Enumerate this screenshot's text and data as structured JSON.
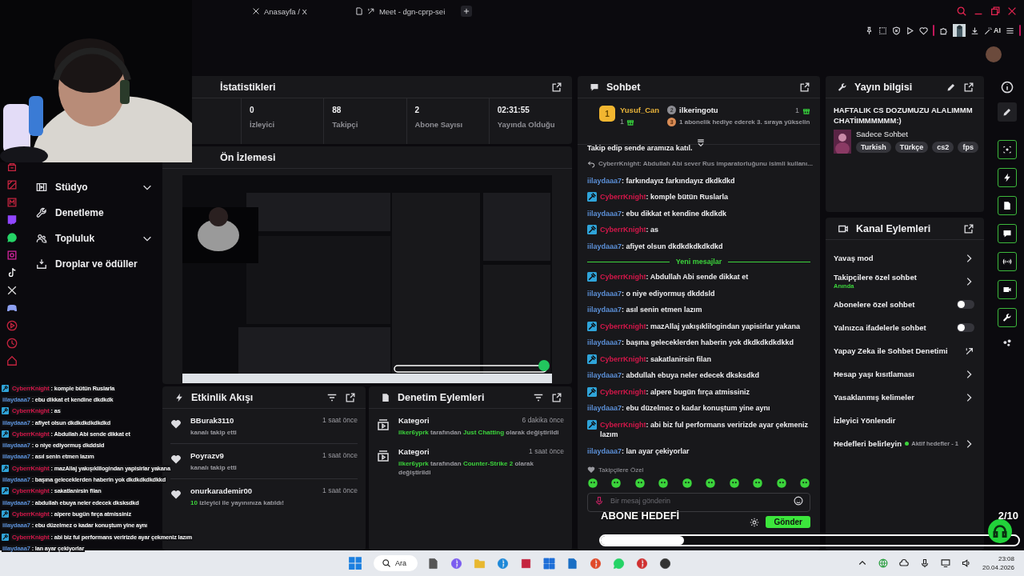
{
  "browser": {
    "tabs": [
      {
        "title": "Anasayfa / X"
      },
      {
        "title": "Meet - dgn-cprp-sei"
      }
    ],
    "toolbar_label": "AI"
  },
  "sidebar": {
    "items": [
      {
        "label": "Stüdyo",
        "expandable": true
      },
      {
        "label": "Denetleme",
        "expandable": false
      },
      {
        "label": "Topluluk",
        "expandable": true
      },
      {
        "label": "Droplar ve ödüller",
        "expandable": false
      }
    ]
  },
  "stats": {
    "title": "İstatistikleri",
    "cells": [
      {
        "value": "0",
        "label": "İzleyici"
      },
      {
        "value": "88",
        "label": "Takipçi"
      },
      {
        "value": "2",
        "label": "Abone Sayısı"
      },
      {
        "value": "02:31:55",
        "label": "Yayında Olduğu"
      }
    ]
  },
  "preview": {
    "title": "Ön İzlemesi",
    "kind": "picture"
  },
  "activity": {
    "title": "Etkinlik Akışı",
    "events": [
      {
        "kind": "follow",
        "user": "BBurak3110",
        "time": "1 saat önce",
        "text": "kanalı takip etti"
      },
      {
        "kind": "follow",
        "user": "Poyrazv9",
        "time": "1 saat önce",
        "text": "kanalı takip etti"
      },
      {
        "kind": "raid",
        "user": "onurkarademir00",
        "time": "1 saat önce",
        "count": "10",
        "text": "izleyici ile yayınınıza katıldı!"
      }
    ]
  },
  "mod_actions": {
    "title": "Denetim Eylemleri",
    "items": [
      {
        "title": "Kategori",
        "time": "6 dakika önce",
        "actor": "ilker6yprk",
        "middle": "tarafından",
        "value": "Just Chatting",
        "tail": "olarak değiştirildi"
      },
      {
        "title": "Kategori",
        "time": "1 saat önce",
        "actor": "ilker6yprk",
        "middle": "tarafından",
        "value": "Counter-Strike 2",
        "tail": "olarak değiştirildi"
      }
    ]
  },
  "chat": {
    "title": "Sohbet",
    "leaders": [
      {
        "rank": "1",
        "name": "Yusuf_Can",
        "count": "1"
      },
      {
        "rank": "2",
        "name": "ilkeringotu",
        "count": "1"
      },
      {
        "rank": "3",
        "text": "1 abonelik hediye ederek 3. sıraya yükselin"
      }
    ],
    "messages": [
      {
        "kind": "notice",
        "text": "Takip edip sende aramıza katıl."
      },
      {
        "kind": "reply",
        "text": "CyberrKnight: Abdullah Abi sever Rus imparatorluğunu isimli kullanı..."
      },
      {
        "kind": "message",
        "user": "iilaydaaa7",
        "color": "#5b8fd6",
        "moderator": false,
        "text": ": farkındayız farkındayız dkdkdkd"
      },
      {
        "kind": "message",
        "user": "CyberrKnight",
        "color": "#d4174a",
        "moderator": true,
        "text": ": komple bütün Ruslarla"
      },
      {
        "kind": "message",
        "user": "iilaydaaa7",
        "color": "#5b8fd6",
        "moderator": false,
        "text": ": ebu dikkat et kendine dkdkdk"
      },
      {
        "kind": "message",
        "user": "CyberrKnight",
        "color": "#d4174a",
        "moderator": true,
        "text": ": as"
      },
      {
        "kind": "message",
        "user": "iilaydaaa7",
        "color": "#5b8fd6",
        "moderator": false,
        "text": ": afiyet olsun dkdkdkdkdkdkd"
      },
      {
        "kind": "divider",
        "text": "Yeni mesajlar"
      },
      {
        "kind": "message",
        "user": "CyberrKnight",
        "color": "#d4174a",
        "moderator": true,
        "text": ": Abdullah Abi sende dikkat et"
      },
      {
        "kind": "message",
        "user": "iilaydaaa7",
        "color": "#5b8fd6",
        "moderator": false,
        "text": ": o niye ediyormuş dkddsld"
      },
      {
        "kind": "message",
        "user": "iilaydaaa7",
        "color": "#5b8fd6",
        "moderator": false,
        "text": ": asıl senin etmen lazım"
      },
      {
        "kind": "message",
        "user": "CyberrKnight",
        "color": "#d4174a",
        "moderator": true,
        "text": ": mazAllaj yakışıklilogindan yapisirlar yakana"
      },
      {
        "kind": "message",
        "user": "iilaydaaa7",
        "color": "#5b8fd6",
        "moderator": false,
        "text": ": başına geleceklerden haberin yok dkdkdkdkdkkd"
      },
      {
        "kind": "message",
        "user": "CyberrKnight",
        "color": "#d4174a",
        "moderator": true,
        "text": ": sakatlanirsin filan"
      },
      {
        "kind": "message",
        "user": "iilaydaaa7",
        "color": "#5b8fd6",
        "moderator": false,
        "text": ": abdullah ebuya neler edecek dksksdkd"
      },
      {
        "kind": "message",
        "user": "CyberrKnight",
        "color": "#d4174a",
        "moderator": true,
        "text": ": alpere bugün fırça atmissiniz"
      },
      {
        "kind": "message",
        "user": "iilaydaaa7",
        "color": "#5b8fd6",
        "moderator": false,
        "text": ": ebu düzelmez o kadar konuştum yine aynı"
      },
      {
        "kind": "message",
        "user": "CyberrKnight",
        "color": "#d4174a",
        "moderator": true,
        "text": ": abi biz ful performans veririzde ayar çekmeniz lazım"
      },
      {
        "kind": "message",
        "user": "iilaydaaa7",
        "color": "#5b8fd6",
        "moderator": false,
        "text": ": lan ayar çekiyorlar"
      }
    ],
    "emote_section": "Takipçilere Özel",
    "placeholder": "Bir mesaj gönderin",
    "send": "Gönder"
  },
  "stream_info": {
    "title": "Yayın bilgisi",
    "stream_title": "HAFTALIK CS DOZUMUZU ALALIMMM CHATİIMMMMMM:)",
    "category": "Sadece Sohbet",
    "tags": [
      "Turkish",
      "Türkçe",
      "cs2",
      "fps"
    ]
  },
  "channel_actions": {
    "title": "Kanal Eylemleri",
    "items": [
      {
        "kind": "link",
        "label": "Yavaş mod"
      },
      {
        "kind": "link",
        "label": "Takipçilere özel sohbet",
        "sub": "Anında"
      },
      {
        "kind": "toggle",
        "label": "Abonelere özel sohbet",
        "on": false
      },
      {
        "kind": "toggle",
        "label": "Yalnızca ifadelerle sohbet",
        "on": false
      },
      {
        "kind": "external",
        "label": "Yapay Zeka ile Sohbet Denetimi"
      },
      {
        "kind": "link",
        "label": "Hesap yaşı kısıtlaması"
      },
      {
        "kind": "link",
        "label": "Yasaklanmış kelimeler"
      },
      {
        "kind": "plain",
        "label": "İzleyici Yönlendir"
      },
      {
        "kind": "link",
        "label": "Hedefleri belirleyin",
        "status": "Aktif hedefler - 1"
      }
    ]
  },
  "overlay_chat": [
    {
      "user": "CyberrKnight",
      "color": "#d4174a",
      "moderator": true,
      "text": ": komple bütün Ruslarla"
    },
    {
      "user": "iilaydaaa7",
      "color": "#5b8fd6",
      "moderator": false,
      "text": ": ebu dikkat et kendine dkdkdk"
    },
    {
      "user": "CyberrKnight",
      "color": "#d4174a",
      "moderator": true,
      "text": ": as"
    },
    {
      "user": "iilaydaaa7",
      "color": "#5b8fd6",
      "moderator": false,
      "text": ": afiyet olsun dkdkdkdkdkdkd"
    },
    {
      "user": "CyberrKnight",
      "color": "#d4174a",
      "moderator": true,
      "text": ": Abdullah Abi sende dikkat et"
    },
    {
      "user": "iilaydaaa7",
      "color": "#5b8fd6",
      "moderator": false,
      "text": ": o niye ediyormuş dkddsld"
    },
    {
      "user": "iilaydaaa7",
      "color": "#5b8fd6",
      "moderator": false,
      "text": ": asıl senin etmen lazım"
    },
    {
      "user": "CyberrKnight",
      "color": "#d4174a",
      "moderator": true,
      "text": ": mazAllaj yakışıklilogindan yapisirlar yakana"
    },
    {
      "user": "iilaydaaa7",
      "color": "#5b8fd6",
      "moderator": false,
      "text": ": başına geleceklerden haberin yok dkdkdkdkdkkd"
    },
    {
      "user": "CyberrKnight",
      "color": "#d4174a",
      "moderator": true,
      "text": ": sakatlanirsin filan"
    },
    {
      "user": "iilaydaaa7",
      "color": "#5b8fd6",
      "moderator": false,
      "text": ": abdullah ebuya neler edecek dksksdkd"
    },
    {
      "user": "CyberrKnight",
      "color": "#d4174a",
      "moderator": true,
      "text": ": alpere bugün fırça atmissiniz"
    },
    {
      "user": "iilaydaaa7",
      "color": "#5b8fd6",
      "moderator": false,
      "text": ": ebu düzelmez o kadar konuştum yine aynı"
    },
    {
      "user": "CyberrKnight",
      "color": "#d4174a",
      "moderator": true,
      "text": ": abi biz ful performans veririzde ayar çekmeniz lazım"
    },
    {
      "user": "iilaydaaa7",
      "color": "#5b8fd6",
      "moderator": false,
      "text": ": lan ayar çekiyorlar"
    }
  ],
  "goal": {
    "title": "ABONE HEDEFİ",
    "count": "2/10",
    "level": 0.2
  },
  "taskbar": {
    "search": "Ara",
    "time": "23:08",
    "date": "20.04.2026"
  }
}
